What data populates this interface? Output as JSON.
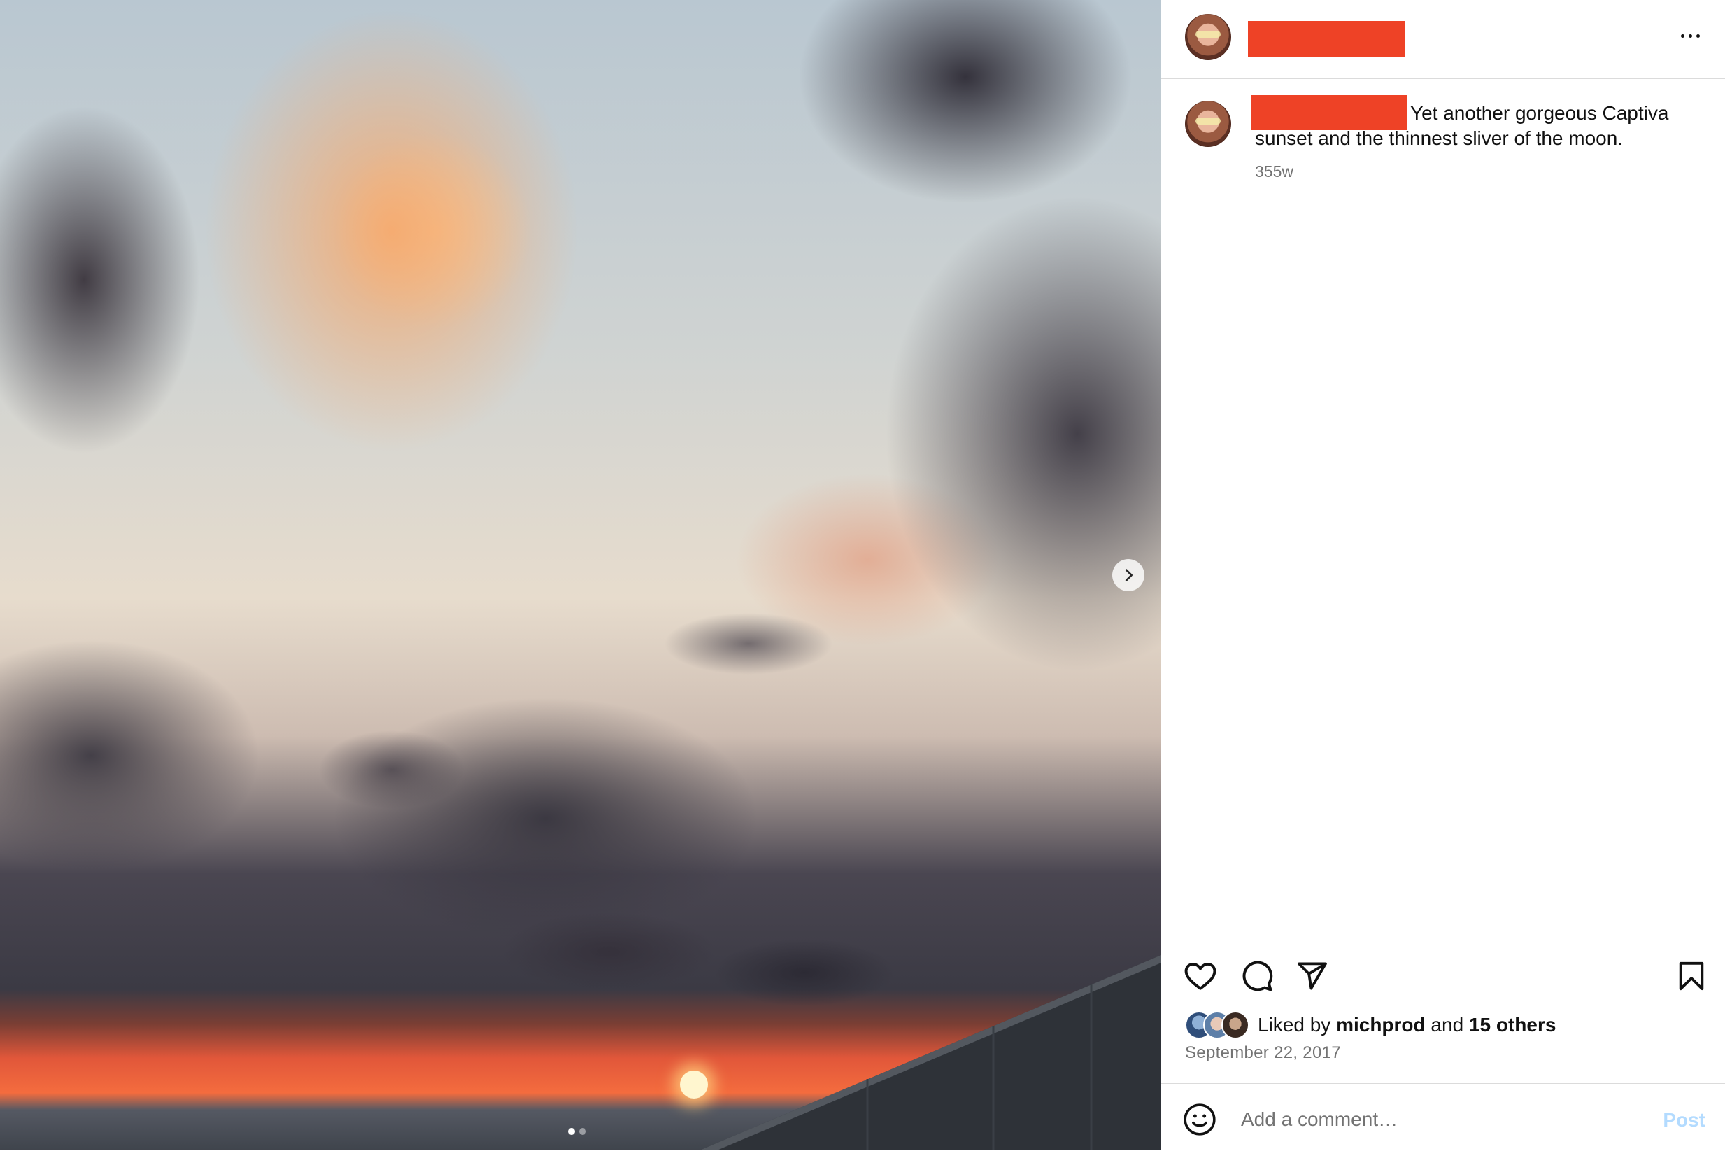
{
  "media": {
    "carousel_total": 2,
    "carousel_current": 1,
    "next_icon": "chevron-right-icon"
  },
  "post_header": {
    "username": "",
    "more_icon": "more-horizontal-icon"
  },
  "caption": {
    "username": "",
    "text": "Yet another gorgeous Captiva sunset and the thinnest sliver of the moon.",
    "time_ago": "355w"
  },
  "actions": {
    "like_icon": "heart-icon",
    "comment_icon": "comment-icon",
    "share_icon": "send-icon",
    "save_icon": "bookmark-icon"
  },
  "likes": {
    "prefix": "Liked by",
    "user": "michprod",
    "joiner": "and",
    "others": "15 others"
  },
  "post_date": "September 22, 2017",
  "comment_box": {
    "placeholder": "Add a comment…",
    "post_label": "Post",
    "emoji_icon": "emoji-icon"
  },
  "colors": {
    "redaction": "#ee4226",
    "post_button_disabled": "#b3dbff",
    "secondary_text": "#737373"
  }
}
